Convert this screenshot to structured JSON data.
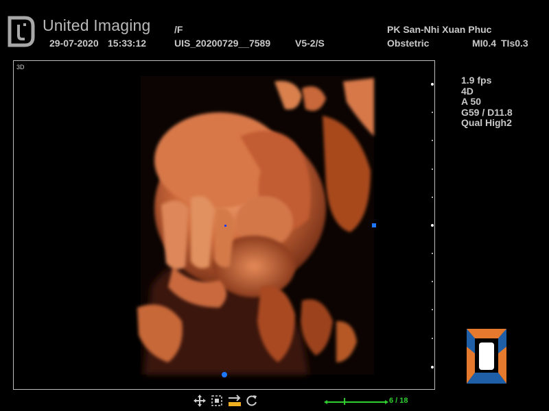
{
  "header": {
    "brand": "United Imaging",
    "preset_suffix": "/F",
    "date": "29-07-2020",
    "time": "15:33:12",
    "study_id": "UIS_20200729__7589",
    "probe": "V5-2/S",
    "institution": "PK San-Nhi Xuan Phuc",
    "exam_type": "Obstetric",
    "mi": "MI0.4",
    "tis": "TIs0.3"
  },
  "viewport": {
    "mode_label": "3D"
  },
  "params": {
    "frame_rate": "1.9 fps",
    "mode": "4D",
    "angle": "A 50",
    "gain_depth": "G59  / D11.8",
    "quality": "Qual High2"
  },
  "cine": {
    "frame_counter": "6 / 18",
    "current_frame": 6,
    "total_frames": 18
  },
  "toolbar": {
    "icons": [
      "move-icon",
      "crop-select-icon",
      "swap-arrows-icon",
      "rotate-icon"
    ]
  },
  "colors": {
    "render_tone": "#c8643a",
    "cine_green": "#30d030",
    "cube_blue": "#1e5fa8",
    "cube_orange": "#e57a2e",
    "marker_blue": "#1e78ff"
  }
}
